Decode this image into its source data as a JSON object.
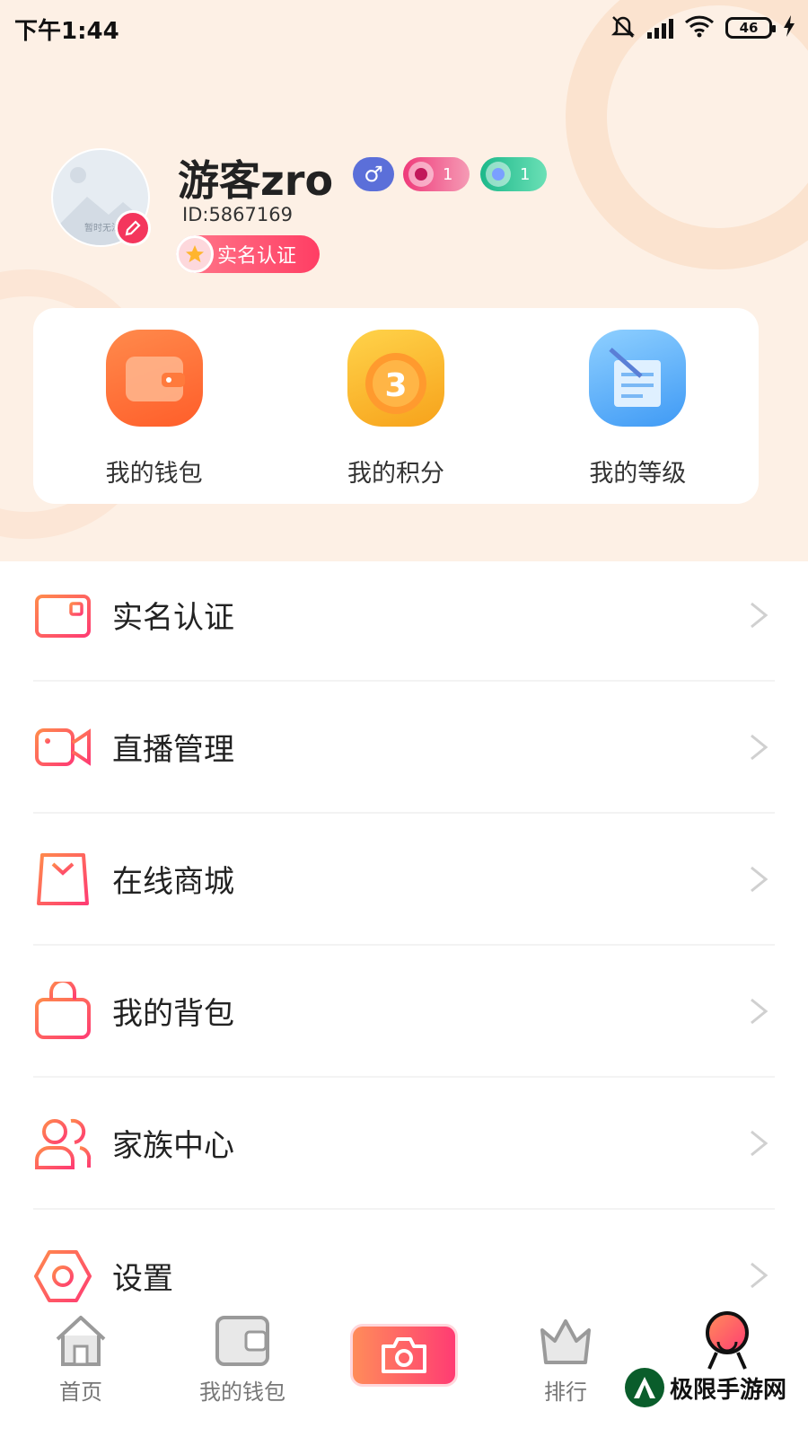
{
  "status_bar": {
    "time": "下午1:44",
    "battery": "46"
  },
  "profile": {
    "username": "游客zro",
    "user_id": "ID:5867169",
    "gender_symbol": "♂",
    "avatar_caption": "暂时无法",
    "badges": [
      {
        "value": "1",
        "color": "#ef3a7a"
      },
      {
        "value": "1",
        "color": "#1cb88a"
      }
    ],
    "realname_badge": "实名认证"
  },
  "quick_actions": [
    {
      "label": "我的钱包",
      "icon": "wallet-icon"
    },
    {
      "label": "我的积分",
      "icon": "points-coin-icon"
    },
    {
      "label": "我的等级",
      "icon": "level-document-icon"
    }
  ],
  "menu": [
    {
      "label": "实名认证",
      "icon": "id-card-icon"
    },
    {
      "label": "直播管理",
      "icon": "video-camera-icon"
    },
    {
      "label": "在线商城",
      "icon": "shopping-bag-icon"
    },
    {
      "label": "我的背包",
      "icon": "backpack-icon"
    },
    {
      "label": "家族中心",
      "icon": "family-group-icon"
    },
    {
      "label": "设置",
      "icon": "settings-hexagon-icon"
    }
  ],
  "bottom_nav": [
    {
      "label": "首页",
      "icon": "home-icon"
    },
    {
      "label": "我的钱包",
      "icon": "wallet-icon"
    },
    {
      "label": "",
      "icon": "camera-icon"
    },
    {
      "label": "排行",
      "icon": "crown-icon"
    },
    {
      "label": "",
      "icon": "profile-avatar-icon"
    }
  ],
  "watermark": "极限手游网",
  "colors": {
    "accent": "#ff3e64",
    "header_bg": "#fdf0e5",
    "gradient_start": "#ff8c5a"
  }
}
